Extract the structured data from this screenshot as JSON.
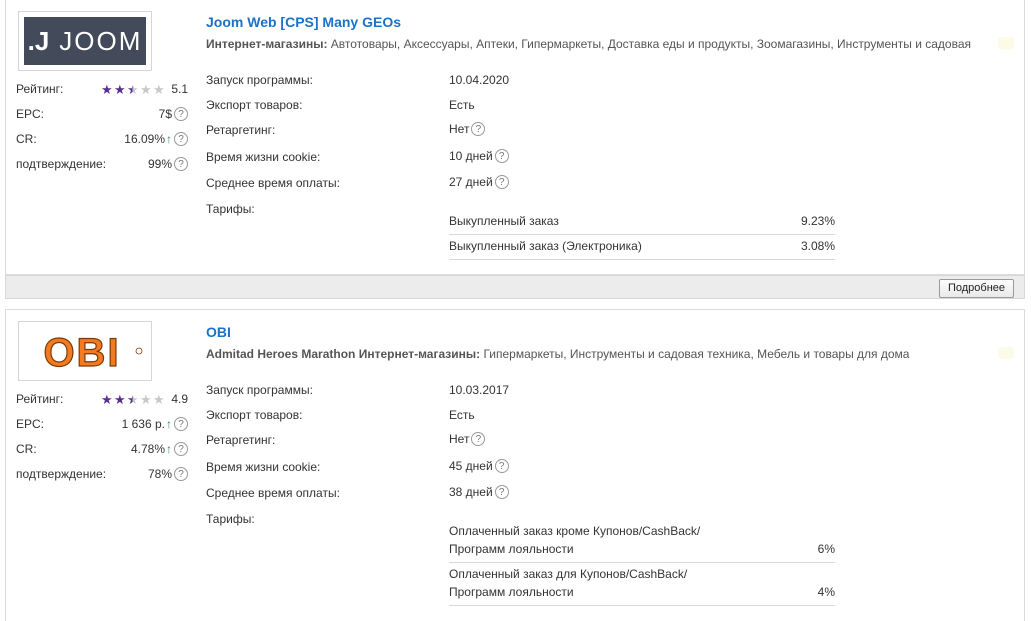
{
  "programs": [
    {
      "logo_text": "JOOM",
      "logo_mark": ".J",
      "title": "Joom Web [CPS] Many GEOs",
      "category_prefix": "Интернет-магазины:",
      "categories": "Автотовары, Аксессуары, Аптеки, Гипермаркеты, Доставка еды и продукты, Зоомагазины, Инструменты и садовая",
      "stats": {
        "rating_label": "Рейтинг:",
        "rating_value": "5.1",
        "rating_stars": 2.5,
        "epc_label": "EPC:",
        "epc_value": "7$",
        "cr_label": "CR:",
        "cr_value": "16.09%",
        "confirm_label": "подтверждение:",
        "confirm_value": "99%"
      },
      "info": {
        "launch_label": "Запуск программы:",
        "launch_value": "10.04.2020",
        "export_label": "Экспорт товаров:",
        "export_value": "Есть",
        "retarget_label": "Ретаргетинг:",
        "retarget_value": "Нет",
        "cookie_label": "Время жизни cookie:",
        "cookie_value": "10 дней",
        "payment_label": "Среднее время оплаты:",
        "payment_value": "27 дней",
        "tariffs_label": "Тарифы:"
      },
      "tariffs": [
        {
          "name": "Выкупленный заказ",
          "value": "9.23%"
        },
        {
          "name": "Выкупленный заказ (Электроника)",
          "value": "3.08%"
        }
      ],
      "more_label": "Подробнее"
    },
    {
      "logo_text": "OBI",
      "title": "OBI",
      "category_prefix": "Admitad Heroes Marathon Интернет-магазины:",
      "categories": "Гипермаркеты, Инструменты и садовая техника, Мебель и товары для дома",
      "stats": {
        "rating_label": "Рейтинг:",
        "rating_value": "4.9",
        "rating_stars": 2.5,
        "epc_label": "EPC:",
        "epc_value": "1 636 р.",
        "cr_label": "CR:",
        "cr_value": "4.78%",
        "confirm_label": "подтверждение:",
        "confirm_value": "78%"
      },
      "info": {
        "launch_label": "Запуск программы:",
        "launch_value": "10.03.2017",
        "export_label": "Экспорт товаров:",
        "export_value": "Есть",
        "retarget_label": "Ретаргетинг:",
        "retarget_value": "Нет",
        "cookie_label": "Время жизни cookie:",
        "cookie_value": "45 дней",
        "payment_label": "Среднее время оплаты:",
        "payment_value": "38 дней",
        "tariffs_label": "Тарифы:"
      },
      "tariffs": [
        {
          "name_line1": "Оплаченный заказ кроме Купонов/CashBack/",
          "name_line2": "Программ лояльности",
          "value": "6%"
        },
        {
          "name_line1": "Оплаченный заказ для Купонов/CashBack/",
          "name_line2": "Программ лояльности",
          "value": "4%"
        }
      ]
    }
  ],
  "colors": {
    "star_filled": "#5a2d91",
    "star_empty": "#c8c8c8",
    "title": "#1a73c8",
    "obi_orange": "#f47a20"
  },
  "help_glyph": "?",
  "up_arrow": "↑"
}
